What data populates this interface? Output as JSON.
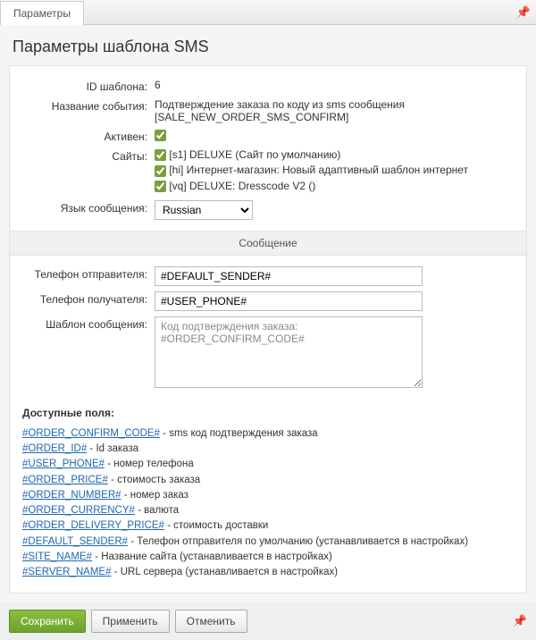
{
  "tabs": {
    "main": "Параметры"
  },
  "page_title": "Параметры шаблона SMS",
  "labels": {
    "template_id": "ID шаблона:",
    "event_name": "Название события:",
    "active": "Активен:",
    "sites": "Сайты:",
    "lang": "Язык сообщения:",
    "section_message": "Сообщение",
    "sender_phone": "Телефон отправителя:",
    "recipient_phone": "Телефон получателя:",
    "template_body": "Шаблон сообщения:",
    "available_fields": "Доступные поля:"
  },
  "values": {
    "template_id": "6",
    "event_name": "Подтверждение заказа по коду из sms сообщения [SALE_NEW_ORDER_SMS_CONFIRM]",
    "active": true,
    "sites": [
      {
        "checked": true,
        "label": "[s1] DELUXE (Сайт по умолчанию)"
      },
      {
        "checked": true,
        "label": "[hi] Интернет-магазин: Новый адаптивный шаблон интернет"
      },
      {
        "checked": true,
        "label": "[vq] DELUXE: Dresscode V2 ()"
      }
    ],
    "lang_selected": "Russian",
    "sender_phone": "#DEFAULT_SENDER#",
    "recipient_phone": "#USER_PHONE#",
    "template_body": "Код подтверждения заказа:\n#ORDER_CONFIRM_CODE#"
  },
  "available_fields": [
    {
      "macro": "#ORDER_CONFIRM_CODE#",
      "desc": " - sms код подтверждения заказа"
    },
    {
      "macro": "#ORDER_ID#",
      "desc": " - Id заказа"
    },
    {
      "macro": "#USER_PHONE#",
      "desc": " - номер телефона"
    },
    {
      "macro": "#ORDER_PRICE#",
      "desc": " - стоимость заказа"
    },
    {
      "macro": "#ORDER_NUMBER#",
      "desc": " - номер заказ"
    },
    {
      "macro": "#ORDER_CURRENCY#",
      "desc": " - валюта"
    },
    {
      "macro": "#ORDER_DELIVERY_PRICE#",
      "desc": " - стоимость доставки"
    },
    {
      "macro": "#DEFAULT_SENDER#",
      "desc": " - Телефон отправителя по умолчанию (устанавливается в настройках)"
    },
    {
      "macro": "#SITE_NAME#",
      "desc": " - Название сайта (устанавливается в настройках)"
    },
    {
      "macro": "#SERVER_NAME#",
      "desc": " - URL сервера (устанавливается в настройках)"
    }
  ],
  "buttons": {
    "save": "Сохранить",
    "apply": "Применить",
    "cancel": "Отменить"
  }
}
